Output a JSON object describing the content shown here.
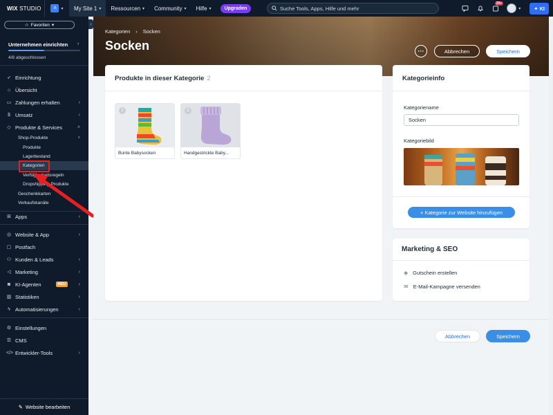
{
  "topbar": {
    "logo_bold": "WIX",
    "logo_rest": " STUDIO",
    "site_avatar_letter": "A",
    "nav": [
      "My Site 1",
      "Ressourcen",
      "Community",
      "Hilfe"
    ],
    "upgrade_label": "Upgraden",
    "search_placeholder": "Suche Tools, Apps, Hilfe und mehr",
    "notifications_badge": "20+",
    "ki_label": "KI"
  },
  "sidebar": {
    "favorites_label": "Favoriten",
    "setup_title": "Unternehmen einrichten",
    "progress_text": "4/8 abgeschlossen",
    "progress_fraction": 0.5,
    "items_top": [
      {
        "label": "Einrichtung",
        "icon": "rocket-icon"
      },
      {
        "label": "Übersicht",
        "icon": "home-icon"
      },
      {
        "label": "Zahlungen erhalten",
        "icon": "card-icon"
      },
      {
        "label": "Umsatz",
        "icon": "dollar-icon"
      },
      {
        "label": "Produkte & Services",
        "icon": "tag-icon"
      }
    ],
    "subitems": [
      "Shop-Produkte",
      "Produkte",
      "Lagerbestand",
      "Kategorien",
      "Verfügbarkeitsregeln",
      "Dropshipping-Produkte",
      "Geschenkkarten",
      "Verkaufskanäle"
    ],
    "items_mid": [
      {
        "label": "Apps",
        "icon": "apps-icon"
      },
      {
        "label": "Website & App",
        "icon": "globe-icon"
      },
      {
        "label": "Postfach",
        "icon": "inbox-icon"
      },
      {
        "label": "Kunden & Leads",
        "icon": "people-icon"
      },
      {
        "label": "Marketing",
        "icon": "megaphone-icon"
      },
      {
        "label": "KI-Agenten",
        "icon": "robot-icon"
      },
      {
        "label": "Statistiken",
        "icon": "chart-icon"
      },
      {
        "label": "Automatisierungen",
        "icon": "bolt-icon"
      }
    ],
    "new_badge": "NEU",
    "items_bottom": [
      {
        "label": "Einstellungen",
        "icon": "gear-icon"
      },
      {
        "label": "CMS",
        "icon": "database-icon"
      },
      {
        "label": "Entwickler-Tools",
        "icon": "code-icon"
      }
    ],
    "edit_site_label": "Website bearbeiten"
  },
  "page": {
    "breadcrumb_parent": "Kategorien",
    "breadcrumb_current": "Socken",
    "title": "Socken",
    "cancel_label": "Abbrechen",
    "save_label": "Speichern"
  },
  "products_card": {
    "heading": "Produkte in dieser Kategorie",
    "count": "2",
    "products": [
      {
        "num": "1",
        "name": "Bunte Babysocken"
      },
      {
        "num": "2",
        "name": "Handgestrickte Baby..."
      }
    ]
  },
  "info_card": {
    "heading": "Kategorieinfo",
    "name_label": "Kategoriename",
    "name_value": "Socken",
    "image_label": "Kategoriebild",
    "add_button": "+ Kategorie zur Website hinzufügen"
  },
  "seo_card": {
    "heading": "Marketing & SEO",
    "rows": [
      {
        "label": "Gutschein erstellen",
        "icon": "coupon-icon"
      },
      {
        "label": "E-Mail-Kampagne versenden",
        "icon": "email-icon"
      }
    ]
  },
  "footer": {
    "cancel_label": "Abbrechen",
    "save_label": "Speichern"
  },
  "colors": {
    "sidebar_bg": "#0f1b2a",
    "accent": "#3a8ee6",
    "highlight": "#e62020",
    "upgrade": "#7a3cf0"
  }
}
